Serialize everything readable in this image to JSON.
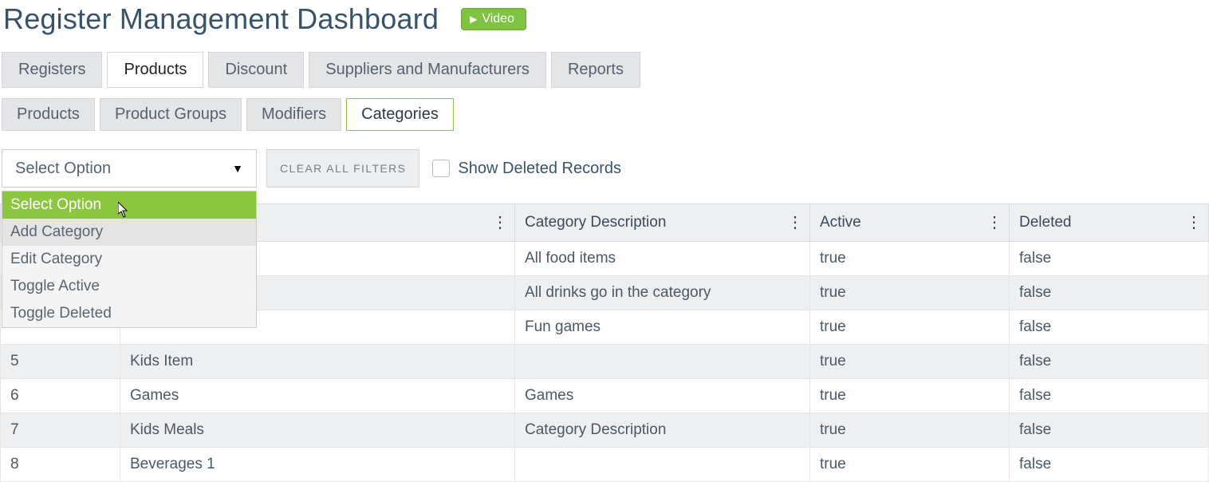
{
  "header": {
    "title": "Register Management Dashboard",
    "video_label": "Video"
  },
  "tabs_primary": {
    "items": [
      {
        "label": "Registers",
        "active": false
      },
      {
        "label": "Products",
        "active": true
      },
      {
        "label": "Discount",
        "active": false
      },
      {
        "label": "Suppliers and Manufacturers",
        "active": false
      },
      {
        "label": "Reports",
        "active": false
      }
    ]
  },
  "tabs_secondary": {
    "items": [
      {
        "label": "Products",
        "active": false
      },
      {
        "label": "Product Groups",
        "active": false
      },
      {
        "label": "Modifiers",
        "active": false
      },
      {
        "label": "Categories",
        "active": true
      }
    ]
  },
  "toolbar": {
    "select_label": "Select Option",
    "clear_label": "CLEAR ALL FILTERS",
    "show_deleted_label": "Show Deleted Records",
    "dropdown": {
      "options": [
        {
          "label": "Select Option",
          "state": "header"
        },
        {
          "label": "Add Category",
          "state": "hover"
        },
        {
          "label": "Edit Category",
          "state": ""
        },
        {
          "label": "Toggle Active",
          "state": ""
        },
        {
          "label": "Toggle Deleted",
          "state": ""
        }
      ]
    }
  },
  "table": {
    "columns": [
      {
        "label": ""
      },
      {
        "label": ""
      },
      {
        "label": "Category Description"
      },
      {
        "label": "Active"
      },
      {
        "label": "Deleted"
      }
    ],
    "rows": [
      {
        "id": "",
        "name": "",
        "desc": "All food items",
        "active": "true",
        "deleted": "false"
      },
      {
        "id": "",
        "name": "",
        "desc": "All drinks go in the category",
        "active": "true",
        "deleted": "false"
      },
      {
        "id": "",
        "name": "",
        "desc": "Fun games",
        "active": "true",
        "deleted": "false"
      },
      {
        "id": "5",
        "name": "Kids Item",
        "desc": "",
        "active": "true",
        "deleted": "false"
      },
      {
        "id": "6",
        "name": "Games",
        "desc": "Games",
        "active": "true",
        "deleted": "false"
      },
      {
        "id": "7",
        "name": "Kids Meals",
        "desc": "Category Description",
        "active": "true",
        "deleted": "false"
      },
      {
        "id": "8",
        "name": "Beverages 1",
        "desc": "",
        "active": "true",
        "deleted": "false"
      }
    ]
  }
}
